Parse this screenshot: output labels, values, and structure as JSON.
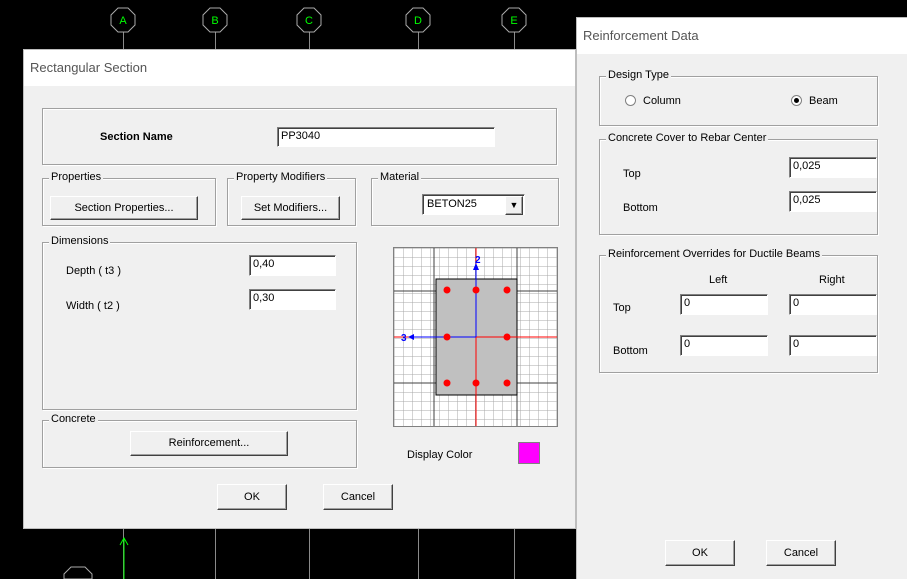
{
  "grid_bubbles": [
    "A",
    "B",
    "C",
    "D",
    "E"
  ],
  "colors": {
    "grid_bubble": "#00ff00",
    "display_color": "#ff00ff",
    "rebar": "#ff0000",
    "axis": "#0000ff"
  },
  "rect_section": {
    "title": "Rectangular Section",
    "section_name_label": "Section Name",
    "section_name_value": "PP3040",
    "properties_legend": "Properties",
    "section_properties_button": "Section Properties...",
    "property_modifiers_legend": "Property Modifiers",
    "set_modifiers_button": "Set Modifiers...",
    "material_legend": "Material",
    "material_value": "BETON25",
    "dimensions_legend": "Dimensions",
    "depth_label": "Depth  ( t3 )",
    "depth_value": "0,40",
    "width_label": "Width  ( t2 )",
    "width_value": "0,30",
    "concrete_legend": "Concrete",
    "reinforcement_button": "Reinforcement...",
    "display_color_label": "Display Color",
    "preview_axis_2": "2",
    "preview_axis_3": "3",
    "ok_button": "OK",
    "cancel_button": "Cancel"
  },
  "reinf_data": {
    "title": "Reinforcement Data",
    "design_type_legend": "Design Type",
    "column_label": "Column",
    "beam_label": "Beam",
    "design_type_selected": "Beam",
    "cover_legend": "Concrete Cover to Rebar Center",
    "cover_top_label": "Top",
    "cover_top_value": "0,025",
    "cover_bottom_label": "Bottom",
    "cover_bottom_value": "0,025",
    "overrides_legend": "Reinforcement Overrides for Ductile Beams",
    "left_header": "Left",
    "right_header": "Right",
    "top_label": "Top",
    "bottom_label": "Bottom",
    "top_left_value": "0",
    "top_right_value": "0",
    "bottom_left_value": "0",
    "bottom_right_value": "0",
    "ok_button": "OK",
    "cancel_button": "Cancel"
  }
}
